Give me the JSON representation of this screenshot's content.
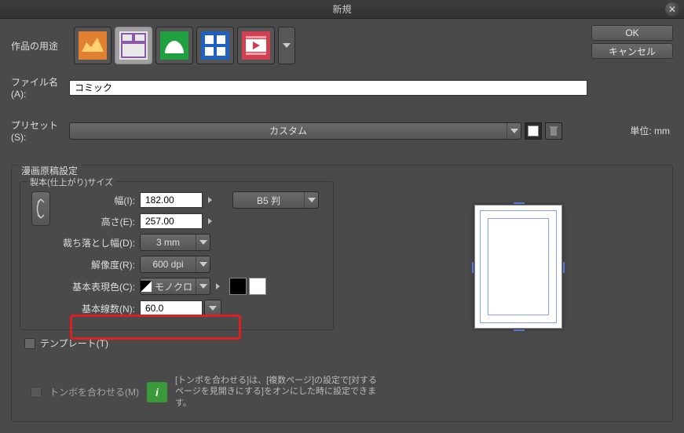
{
  "title": "新規",
  "buttons": {
    "ok": "OK",
    "cancel": "キャンセル"
  },
  "labels": {
    "purpose": "作品の用途",
    "filename": "ファイル名(A):",
    "preset": "プリセット(S):",
    "unit": "単位:  mm",
    "panel": "漫画原稿設定",
    "bind_size": "製本(仕上がり)サイズ",
    "width": "幅(I):",
    "height": "高さ(E):",
    "bleed": "裁ち落とし幅(D):",
    "resolution": "解像度(R):",
    "base_color": "基本表現色(C):",
    "screen_freq": "基本線数(N):",
    "template": "テンプレート(T)",
    "align_crop": "トンボを合わせる(M)"
  },
  "values": {
    "filename": "コミック",
    "preset": "カスタム",
    "width": "182.00",
    "height": "257.00",
    "bleed": "3 mm",
    "resolution": "600 dpi",
    "base_color": "モノクロ",
    "screen_freq": "60.0",
    "paper_size": "B5 判"
  },
  "info_text": "[トンボを合わせる]は、[複数ページ]の設定で[対するページを見開きにする]をオンにした時に設定できます。"
}
